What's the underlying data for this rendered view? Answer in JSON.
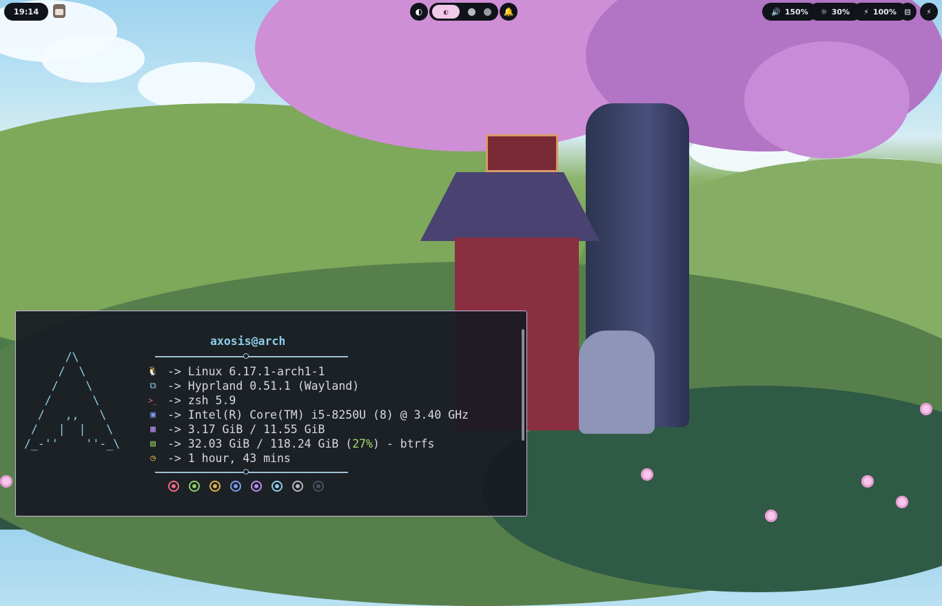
{
  "topbar": {
    "clock": "19:14",
    "workspaces": {
      "left_icon": "◐",
      "active_icon": "◐",
      "right_icon": "🔔"
    },
    "volume": {
      "icon": "🔊",
      "label": "150%"
    },
    "brightness": {
      "icon": "☼",
      "label": "30%"
    },
    "battery": {
      "icon": "⚡",
      "label": "100%"
    },
    "network_icon": "⊟",
    "power_icon": "⚡"
  },
  "terminal": {
    "logo": "      /\\\n     /  \\\n    /    \\\n   /      \\\n  /   ,,   \\\n /   |  |   \\\n/_-''    ''-_\\",
    "user_host": "axosis@arch",
    "rows": [
      {
        "icon": "linux-icon",
        "glyph": "🐧",
        "color": "#e3b14d",
        "text": "-> Linux 6.17.1-arch1-1"
      },
      {
        "icon": "window-manager-icon",
        "glyph": "⧉",
        "color": "#8ccde8",
        "text": "-> Hyprland 0.51.1 (Wayland)"
      },
      {
        "icon": "shell-icon",
        "glyph": "≻_",
        "color": "#ef6b85",
        "text": "-> zsh 5.9"
      },
      {
        "icon": "cpu-icon",
        "glyph": "▣",
        "color": "#7a9bf0",
        "text": "-> Intel(R) Core(TM) i5-8250U (8) @ 3.40 GHz"
      },
      {
        "icon": "memory-icon",
        "glyph": "▦",
        "color": "#b68ef2",
        "text": "-> 3.17 GiB / 11.55 GiB"
      },
      {
        "icon": "disk-icon",
        "glyph": "▤",
        "color": "#8fcf6a",
        "pre": "-> 32.03 GiB / 118.24 GiB (",
        "pct": "27%",
        "post": ") - btrfs"
      },
      {
        "icon": "clock-icon",
        "glyph": "◷",
        "color": "#e3b14d",
        "text": "-> 1 hour, 43 mins"
      }
    ],
    "palette": [
      "#ef6b85",
      "#8fcf6a",
      "#e3b14d",
      "#7a9bf0",
      "#b68ef2",
      "#8ccde8",
      "#b9b8c2",
      "#4a4e62"
    ]
  }
}
